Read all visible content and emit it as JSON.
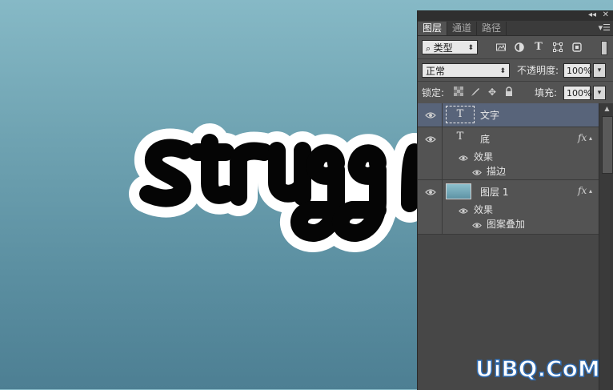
{
  "canvas": {
    "artwork_text": "struggl",
    "colors": {
      "letter": "#050505",
      "outline": "#ffffff"
    }
  },
  "panel": {
    "tabs": [
      {
        "label": "图层",
        "active": true
      },
      {
        "label": "通道",
        "active": false
      },
      {
        "label": "路径",
        "active": false
      }
    ],
    "filter": {
      "kind_label": "类型",
      "icons": [
        "image-filter-icon",
        "adjustment-filter-icon",
        "type-filter-icon",
        "shape-filter-icon",
        "smart-object-filter-icon"
      ]
    },
    "blend": {
      "mode": "正常",
      "opacity_label": "不透明度:",
      "opacity_value": "100%"
    },
    "lock": {
      "label": "锁定:",
      "icons": [
        "lock-transparent-icon",
        "lock-paint-icon",
        "lock-move-icon",
        "lock-all-icon"
      ],
      "fill_label": "填充:",
      "fill_value": "100%"
    },
    "layers": [
      {
        "name": "文字",
        "type": "text",
        "selected": true,
        "visible": true
      },
      {
        "name": "底",
        "type": "text",
        "selected": false,
        "visible": true,
        "fx": "fx",
        "effects_label": "效果",
        "effects": [
          "描边"
        ]
      },
      {
        "name": "图层 1",
        "type": "image",
        "selected": false,
        "visible": true,
        "fx": "fx",
        "effects_label": "效果",
        "effects": [
          "图案叠加"
        ]
      }
    ]
  },
  "watermark": "UiBQ.CoM"
}
